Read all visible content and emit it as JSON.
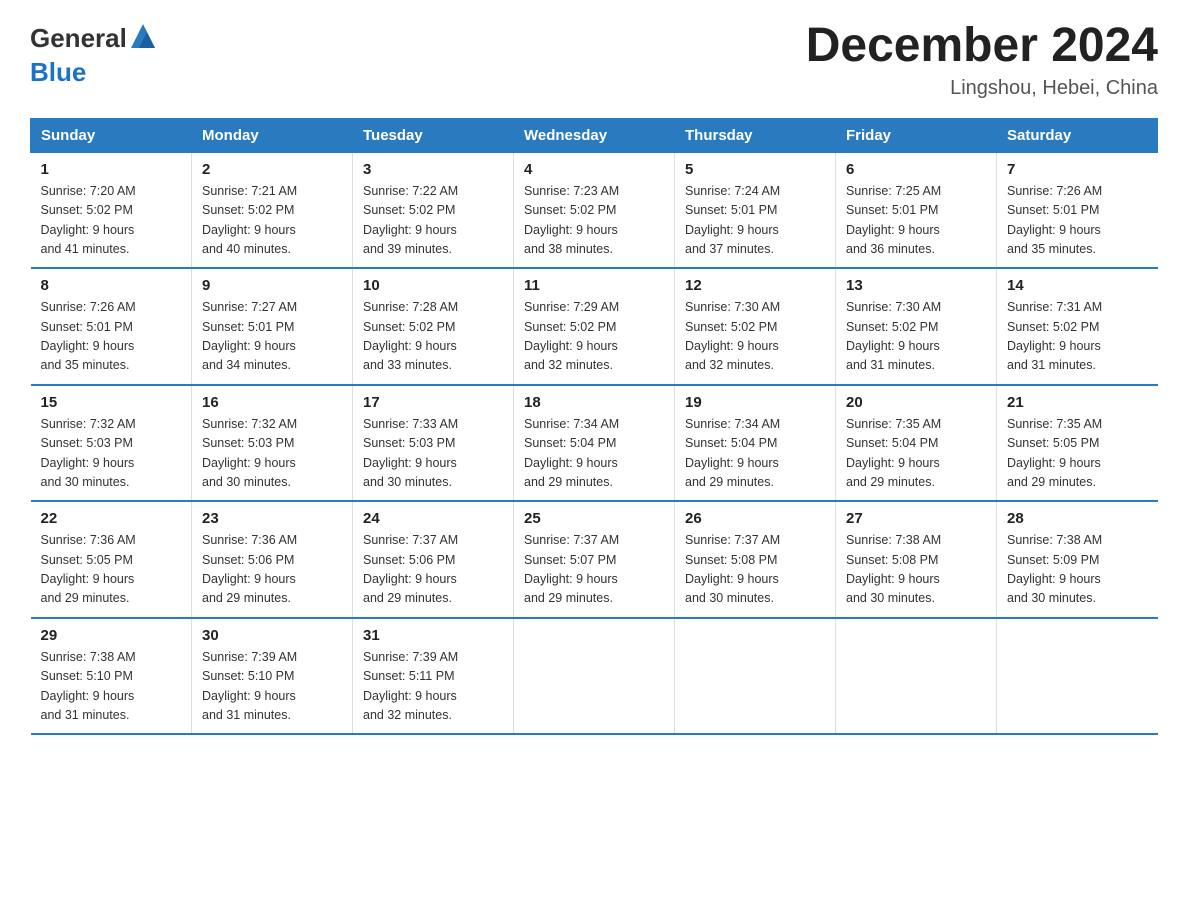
{
  "header": {
    "logo_general": "General",
    "logo_blue": "Blue",
    "month_title": "December 2024",
    "location": "Lingshou, Hebei, China"
  },
  "days_of_week": [
    "Sunday",
    "Monday",
    "Tuesday",
    "Wednesday",
    "Thursday",
    "Friday",
    "Saturday"
  ],
  "weeks": [
    [
      {
        "day": "1",
        "sunrise": "7:20 AM",
        "sunset": "5:02 PM",
        "daylight": "9 hours and 41 minutes."
      },
      {
        "day": "2",
        "sunrise": "7:21 AM",
        "sunset": "5:02 PM",
        "daylight": "9 hours and 40 minutes."
      },
      {
        "day": "3",
        "sunrise": "7:22 AM",
        "sunset": "5:02 PM",
        "daylight": "9 hours and 39 minutes."
      },
      {
        "day": "4",
        "sunrise": "7:23 AM",
        "sunset": "5:02 PM",
        "daylight": "9 hours and 38 minutes."
      },
      {
        "day": "5",
        "sunrise": "7:24 AM",
        "sunset": "5:01 PM",
        "daylight": "9 hours and 37 minutes."
      },
      {
        "day": "6",
        "sunrise": "7:25 AM",
        "sunset": "5:01 PM",
        "daylight": "9 hours and 36 minutes."
      },
      {
        "day": "7",
        "sunrise": "7:26 AM",
        "sunset": "5:01 PM",
        "daylight": "9 hours and 35 minutes."
      }
    ],
    [
      {
        "day": "8",
        "sunrise": "7:26 AM",
        "sunset": "5:01 PM",
        "daylight": "9 hours and 35 minutes."
      },
      {
        "day": "9",
        "sunrise": "7:27 AM",
        "sunset": "5:01 PM",
        "daylight": "9 hours and 34 minutes."
      },
      {
        "day": "10",
        "sunrise": "7:28 AM",
        "sunset": "5:02 PM",
        "daylight": "9 hours and 33 minutes."
      },
      {
        "day": "11",
        "sunrise": "7:29 AM",
        "sunset": "5:02 PM",
        "daylight": "9 hours and 32 minutes."
      },
      {
        "day": "12",
        "sunrise": "7:30 AM",
        "sunset": "5:02 PM",
        "daylight": "9 hours and 32 minutes."
      },
      {
        "day": "13",
        "sunrise": "7:30 AM",
        "sunset": "5:02 PM",
        "daylight": "9 hours and 31 minutes."
      },
      {
        "day": "14",
        "sunrise": "7:31 AM",
        "sunset": "5:02 PM",
        "daylight": "9 hours and 31 minutes."
      }
    ],
    [
      {
        "day": "15",
        "sunrise": "7:32 AM",
        "sunset": "5:03 PM",
        "daylight": "9 hours and 30 minutes."
      },
      {
        "day": "16",
        "sunrise": "7:32 AM",
        "sunset": "5:03 PM",
        "daylight": "9 hours and 30 minutes."
      },
      {
        "day": "17",
        "sunrise": "7:33 AM",
        "sunset": "5:03 PM",
        "daylight": "9 hours and 30 minutes."
      },
      {
        "day": "18",
        "sunrise": "7:34 AM",
        "sunset": "5:04 PM",
        "daylight": "9 hours and 29 minutes."
      },
      {
        "day": "19",
        "sunrise": "7:34 AM",
        "sunset": "5:04 PM",
        "daylight": "9 hours and 29 minutes."
      },
      {
        "day": "20",
        "sunrise": "7:35 AM",
        "sunset": "5:04 PM",
        "daylight": "9 hours and 29 minutes."
      },
      {
        "day": "21",
        "sunrise": "7:35 AM",
        "sunset": "5:05 PM",
        "daylight": "9 hours and 29 minutes."
      }
    ],
    [
      {
        "day": "22",
        "sunrise": "7:36 AM",
        "sunset": "5:05 PM",
        "daylight": "9 hours and 29 minutes."
      },
      {
        "day": "23",
        "sunrise": "7:36 AM",
        "sunset": "5:06 PM",
        "daylight": "9 hours and 29 minutes."
      },
      {
        "day": "24",
        "sunrise": "7:37 AM",
        "sunset": "5:06 PM",
        "daylight": "9 hours and 29 minutes."
      },
      {
        "day": "25",
        "sunrise": "7:37 AM",
        "sunset": "5:07 PM",
        "daylight": "9 hours and 29 minutes."
      },
      {
        "day": "26",
        "sunrise": "7:37 AM",
        "sunset": "5:08 PM",
        "daylight": "9 hours and 30 minutes."
      },
      {
        "day": "27",
        "sunrise": "7:38 AM",
        "sunset": "5:08 PM",
        "daylight": "9 hours and 30 minutes."
      },
      {
        "day": "28",
        "sunrise": "7:38 AM",
        "sunset": "5:09 PM",
        "daylight": "9 hours and 30 minutes."
      }
    ],
    [
      {
        "day": "29",
        "sunrise": "7:38 AM",
        "sunset": "5:10 PM",
        "daylight": "9 hours and 31 minutes."
      },
      {
        "day": "30",
        "sunrise": "7:39 AM",
        "sunset": "5:10 PM",
        "daylight": "9 hours and 31 minutes."
      },
      {
        "day": "31",
        "sunrise": "7:39 AM",
        "sunset": "5:11 PM",
        "daylight": "9 hours and 32 minutes."
      },
      null,
      null,
      null,
      null
    ]
  ],
  "labels": {
    "sunrise": "Sunrise:",
    "sunset": "Sunset:",
    "daylight": "Daylight:"
  }
}
